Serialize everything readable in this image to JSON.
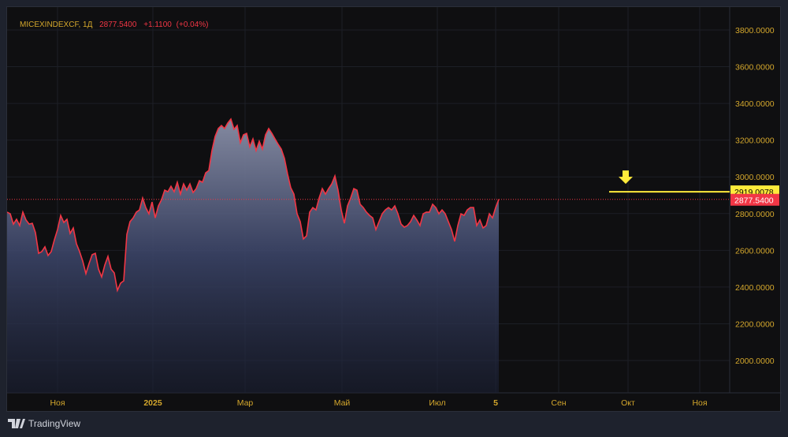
{
  "header": {
    "symbol": "MICEXINDEXCF, 1Д",
    "last": "2877.5400",
    "change": "+1.1100",
    "change_pct": "(+0.04%)"
  },
  "footer": {
    "brand": "TradingView"
  },
  "colors": {
    "line": "#f23645",
    "axis_text": "#d4a72c",
    "alert": "#ffeb3b",
    "bg": "#0f0f11"
  },
  "chart_data": {
    "type": "area",
    "title": "MICEXINDEXCF, 1Д",
    "ylim": [
      1900,
      3880
    ],
    "y_ticks": [
      "3800.0000",
      "3600.0000",
      "3400.0000",
      "3200.0000",
      "3000.0000",
      "2800.0000",
      "2600.0000",
      "2400.0000",
      "2200.0000",
      "2000.0000"
    ],
    "y_tick_values": [
      3800,
      3600,
      3400,
      3200,
      3000,
      2800,
      2600,
      2400,
      2200,
      2000
    ],
    "x_ticks": [
      "Ноя",
      "2025",
      "Мар",
      "Май",
      "Июл",
      "5",
      "Сен",
      "Окт",
      "Ноя"
    ],
    "grid": true,
    "values": [
      2808,
      2799,
      2743,
      2769,
      2735,
      2808,
      2765,
      2743,
      2747,
      2696,
      2584,
      2593,
      2619,
      2572,
      2593,
      2657,
      2713,
      2790,
      2752,
      2769,
      2692,
      2722,
      2636,
      2593,
      2541,
      2473,
      2528,
      2576,
      2584,
      2498,
      2455,
      2520,
      2567,
      2498,
      2477,
      2382,
      2421,
      2434,
      2687,
      2756,
      2777,
      2808,
      2820,
      2885,
      2833,
      2799,
      2863,
      2777,
      2842,
      2876,
      2928,
      2919,
      2949,
      2919,
      2971,
      2906,
      2962,
      2928,
      2962,
      2915,
      2936,
      2979,
      2971,
      3022,
      3035,
      3143,
      3220,
      3263,
      3280,
      3263,
      3293,
      3315,
      3259,
      3280,
      3186,
      3229,
      3237,
      3164,
      3207,
      3143,
      3194,
      3151,
      3229,
      3263,
      3237,
      3207,
      3177,
      3151,
      3100,
      3014,
      2941,
      2906,
      2799,
      2756,
      2662,
      2679,
      2808,
      2833,
      2820,
      2885,
      2936,
      2906,
      2936,
      2962,
      3005,
      2928,
      2820,
      2747,
      2842,
      2885,
      2936,
      2928,
      2851,
      2833,
      2808,
      2790,
      2777,
      2713,
      2756,
      2799,
      2820,
      2833,
      2820,
      2842,
      2799,
      2743,
      2726,
      2735,
      2756,
      2790,
      2765,
      2735,
      2799,
      2808,
      2808,
      2851,
      2833,
      2799,
      2820,
      2799,
      2756,
      2713,
      2649,
      2735,
      2799,
      2790,
      2820,
      2833,
      2833,
      2735,
      2765,
      2722,
      2735,
      2799,
      2777,
      2833,
      2877.54
    ],
    "last_price_label": "2877.5400",
    "alert_level": 2919.0078,
    "alert_label": "2919.0078"
  }
}
